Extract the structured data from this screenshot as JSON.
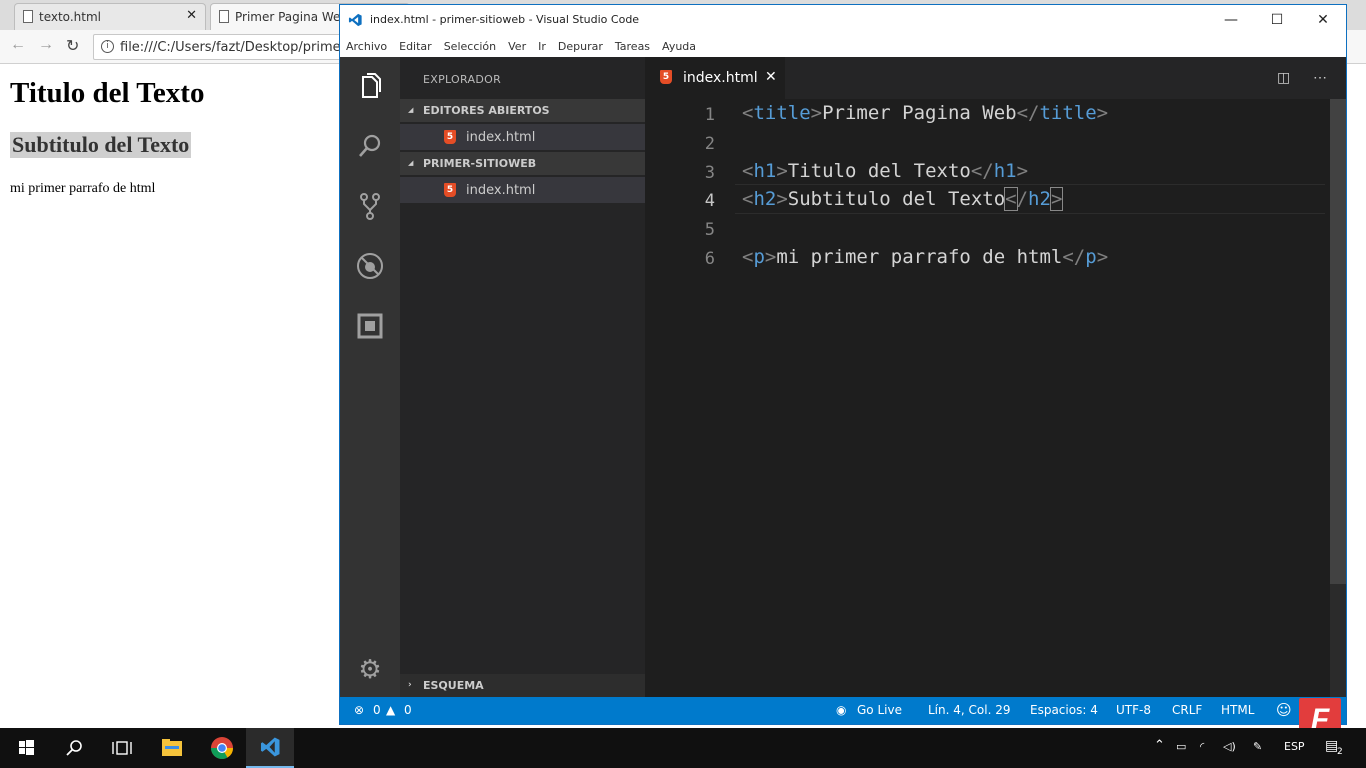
{
  "browser": {
    "tabs": [
      {
        "label": "texto.html"
      },
      {
        "label": "Primer Pagina Web"
      }
    ],
    "address": "file:///C:/Users/fazt/Desktop/primer",
    "page": {
      "h1": "Titulo del Texto",
      "h2": "Subtitulo del Texto",
      "p": "mi primer parrafo de html"
    }
  },
  "vscode": {
    "title": "index.html - primer-sitioweb - Visual Studio Code",
    "menu": [
      "Archivo",
      "Editar",
      "Selección",
      "Ver",
      "Ir",
      "Depurar",
      "Tareas",
      "Ayuda"
    ],
    "sidebar": {
      "header": "EXPLORADOR",
      "open_editors": "EDITORES ABIERTOS",
      "open_file": "index.html",
      "folder": "PRIMER-SITIOWEB",
      "folder_file": "index.html",
      "outline": "ESQUEMA"
    },
    "tab": "index.html",
    "code": {
      "line_numbers": [
        "1",
        "2",
        "3",
        "4",
        "5",
        "6"
      ],
      "l1": {
        "open": "title",
        "text": "Primer Pagina Web",
        "close": "title"
      },
      "l3": {
        "open": "h1",
        "text": "Titulo del Texto",
        "close": "h1"
      },
      "l4": {
        "open": "h2",
        "text": "Subtitulo del Texto",
        "close": "h2"
      },
      "l6": {
        "open": "p",
        "text": "mi primer parrafo de html",
        "close": "p"
      }
    },
    "status": {
      "errors": "0",
      "warnings": "0",
      "golive": "Go Live",
      "position": "Lín. 4, Col. 29",
      "spaces": "Espacios: 4",
      "encoding": "UTF-8",
      "eol": "CRLF",
      "language": "HTML"
    }
  },
  "taskbar": {
    "lang": "ESP",
    "notifications": "2"
  },
  "watermark": "F",
  "colors": {
    "statusbar": "#007acc",
    "tag": "#569cd6",
    "html_icon": "#e44d26"
  }
}
